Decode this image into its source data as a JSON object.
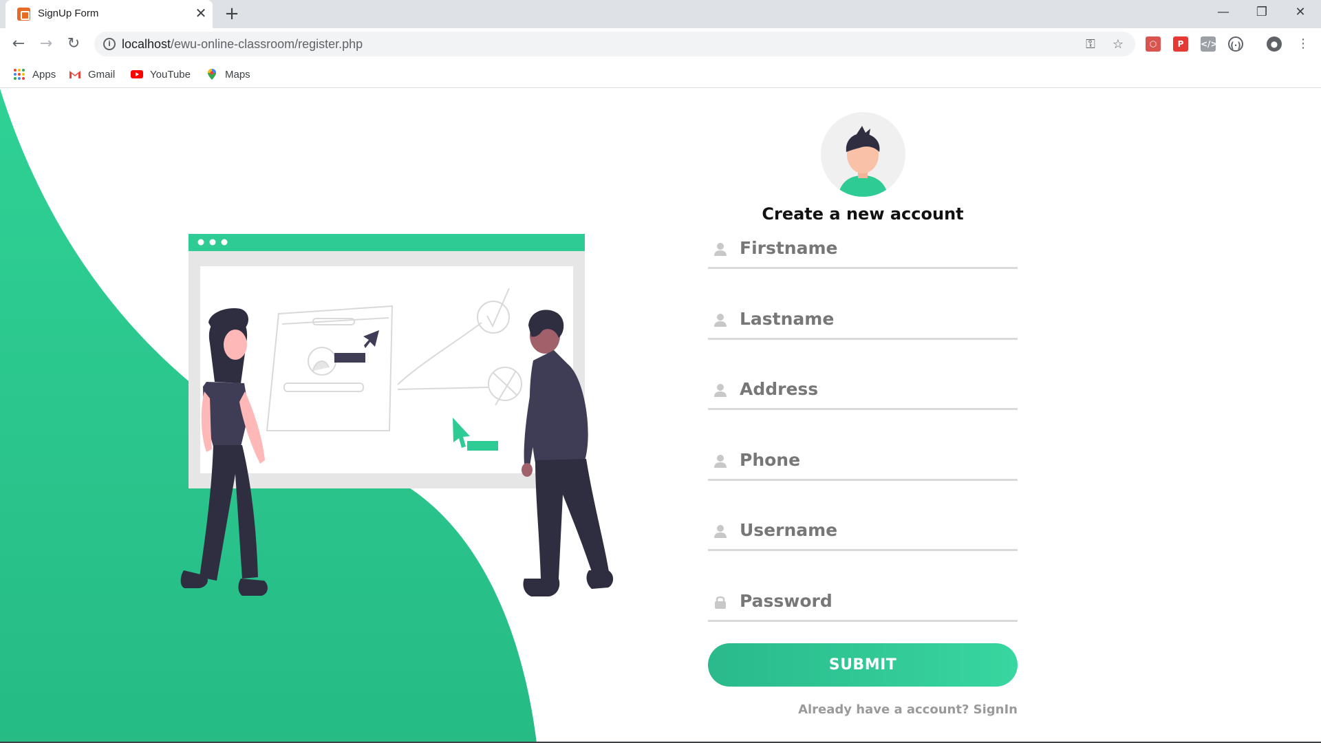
{
  "browser": {
    "tab_title": "SignUp Form",
    "url_host": "localhost",
    "url_path": "/ewu-online-classroom/register.php",
    "bookmarks": [
      {
        "label": "Apps",
        "icon": "apps-grid-icon"
      },
      {
        "label": "Gmail",
        "icon": "gmail-icon"
      },
      {
        "label": "YouTube",
        "icon": "youtube-icon"
      },
      {
        "label": "Maps",
        "icon": "maps-icon"
      }
    ]
  },
  "form": {
    "title": "Create a new account",
    "fields": [
      {
        "placeholder": "Firstname",
        "icon": "user-icon"
      },
      {
        "placeholder": "Lastname",
        "icon": "user-icon"
      },
      {
        "placeholder": "Address",
        "icon": "user-icon"
      },
      {
        "placeholder": "Phone",
        "icon": "user-icon"
      },
      {
        "placeholder": "Username",
        "icon": "user-icon"
      },
      {
        "placeholder": "Password",
        "icon": "lock-icon"
      }
    ],
    "submit_label": "SUBMIT",
    "signin_text": "Already have a account? SignIn"
  },
  "colors": {
    "accent": "#2ecc94",
    "accent_dark": "#24b583",
    "text_dark": "#111111",
    "placeholder": "#777777"
  }
}
